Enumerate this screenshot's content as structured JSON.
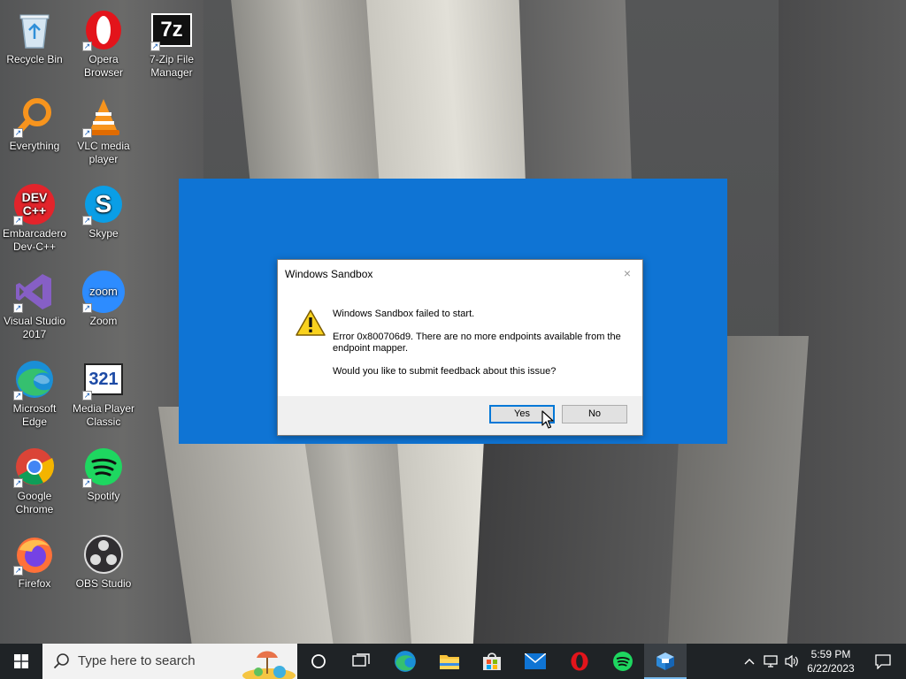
{
  "desktop": {
    "icons": [
      {
        "label": "Recycle Bin",
        "icon": "recycle-bin-icon"
      },
      {
        "label": "Opera Browser",
        "icon": "opera-icon"
      },
      {
        "label": "7-Zip File Manager",
        "icon": "7zip-icon"
      },
      {
        "label": "Everything",
        "icon": "everything-icon"
      },
      {
        "label": "VLC media player",
        "icon": "vlc-icon"
      },
      {
        "label": "Embarcadero Dev-C++",
        "icon": "devcpp-icon"
      },
      {
        "label": "Skype",
        "icon": "skype-icon"
      },
      {
        "label": "Visual Studio 2017",
        "icon": "visual-studio-icon"
      },
      {
        "label": "Zoom",
        "icon": "zoom-icon"
      },
      {
        "label": "Microsoft Edge",
        "icon": "edge-icon"
      },
      {
        "label": "Media Player Classic",
        "icon": "mpc-icon"
      },
      {
        "label": "Google Chrome",
        "icon": "chrome-icon"
      },
      {
        "label": "Spotify",
        "icon": "spotify-icon"
      },
      {
        "label": "Firefox",
        "icon": "firefox-icon"
      },
      {
        "label": "OBS Studio",
        "icon": "obs-icon"
      }
    ],
    "icon_glyphs": {
      "sevenzip": "7z",
      "devcpp_top": "DEV",
      "devcpp_bottom": "C++",
      "skype": "S",
      "zoom": "zoom",
      "mpc": "321"
    }
  },
  "dialog": {
    "title": "Windows Sandbox",
    "close": "×",
    "heading": "Windows Sandbox failed to start.",
    "error": "Error 0x800706d9. There are no more endpoints available from the endpoint mapper.",
    "question": "Would you like to submit feedback about this issue?",
    "yes_label": "Yes",
    "no_label": "No"
  },
  "taskbar": {
    "search_placeholder": "Type here to search",
    "pinned": [
      "task-view-icon",
      "edge-icon",
      "file-explorer-icon",
      "microsoft-store-icon",
      "mail-icon",
      "opera-icon",
      "spotify-icon",
      "windows-sandbox-icon"
    ],
    "clock_time": "5:59 PM",
    "clock_date": "6/22/2023"
  },
  "colors": {
    "sandbox_blue": "#0f74d4",
    "taskbar": "#1f2326",
    "accent": "#0078d7"
  }
}
